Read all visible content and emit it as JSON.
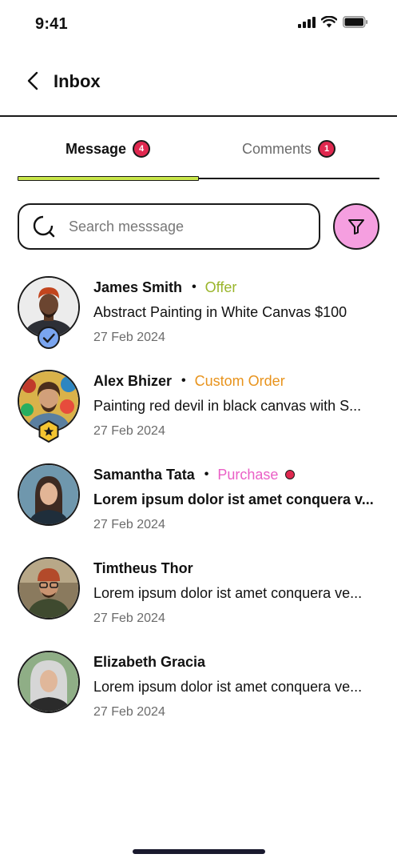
{
  "status_bar": {
    "time": "9:41"
  },
  "header": {
    "title": "Inbox"
  },
  "tabs": [
    {
      "label": "Message",
      "badge": "4",
      "active": true
    },
    {
      "label": "Comments",
      "badge": "1",
      "active": false
    }
  ],
  "search": {
    "placeholder": "Search messsage",
    "value": ""
  },
  "colors": {
    "tab_indicator": "#c8e64a",
    "badge": "#e0284f",
    "filter_button": "#f59fe0",
    "offer": "#9ab52a",
    "custom_order": "#e8931c",
    "purchase": "#ea5fc6"
  },
  "messages": [
    {
      "name": "James Smith",
      "tag": "Offer",
      "tag_color": "#9ab52a",
      "preview": "Abstract Painting in White Canvas $100",
      "date": "27 Feb 2024",
      "unread": false,
      "badge_icon": "verified-check-icon"
    },
    {
      "name": "Alex Bhizer",
      "tag": "Custom Order",
      "tag_color": "#e8931c",
      "preview": "Painting red devil in black canvas with S...",
      "date": "27 Feb 2024",
      "unread": false,
      "badge_icon": "star-hexagon-icon"
    },
    {
      "name": "Samantha Tata",
      "tag": "Purchase",
      "tag_color": "#ea5fc6",
      "preview": "Lorem ipsum dolor ist amet conquera v...",
      "date": "27 Feb 2024",
      "unread": true,
      "badge_icon": ""
    },
    {
      "name": "Timtheus Thor",
      "tag": "",
      "tag_color": "",
      "preview": "Lorem ipsum dolor ist amet conquera ve...",
      "date": "27 Feb 2024",
      "unread": false,
      "badge_icon": ""
    },
    {
      "name": "Elizabeth Gracia",
      "tag": "",
      "tag_color": "",
      "preview": "Lorem ipsum dolor ist amet conquera ve...",
      "date": "27 Feb 2024",
      "unread": false,
      "badge_icon": ""
    }
  ]
}
